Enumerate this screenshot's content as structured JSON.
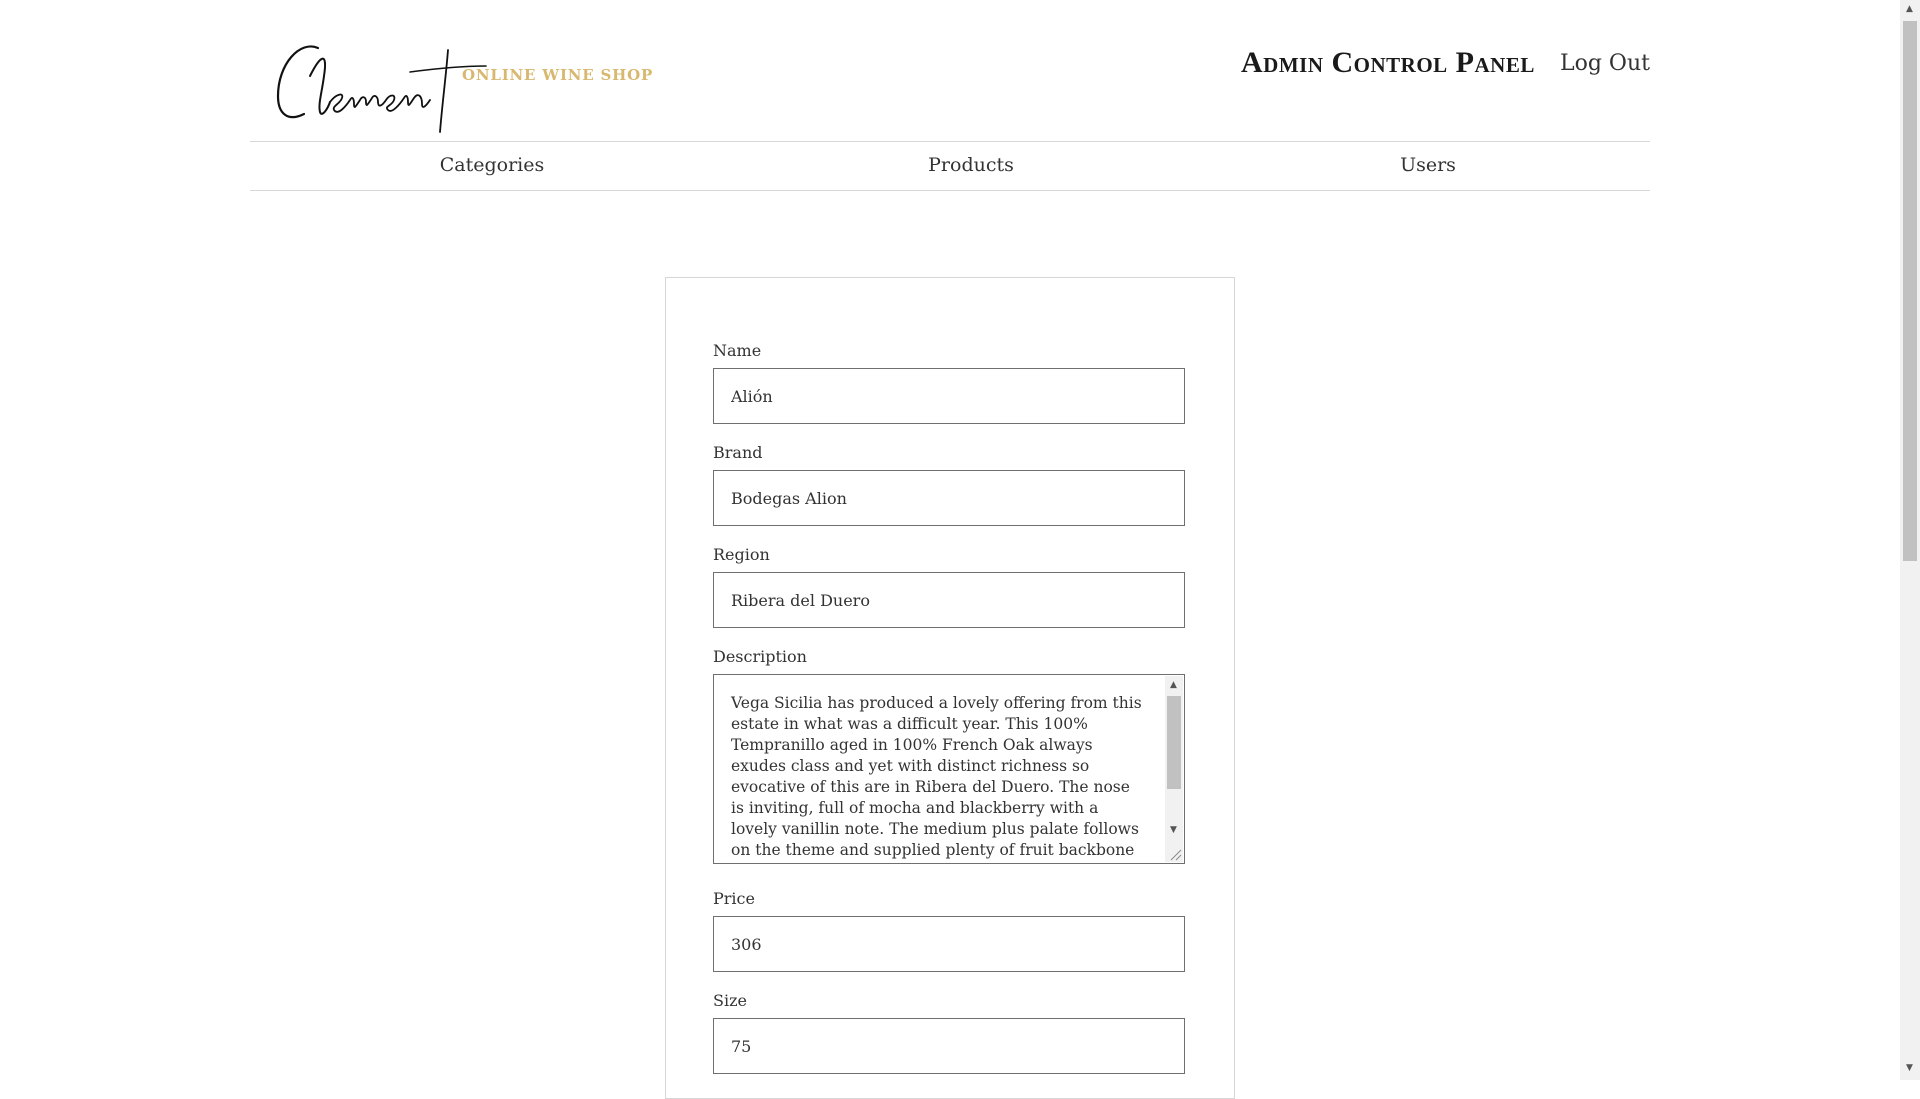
{
  "header": {
    "logo_script": "Clement",
    "logo_tagline": "ONLINE WINE SHOP",
    "admin_title": "Admin Control Panel",
    "logout_label": "Log Out"
  },
  "nav": {
    "items": [
      {
        "label": "Categories"
      },
      {
        "label": "Products"
      },
      {
        "label": "Users"
      }
    ]
  },
  "form": {
    "name": {
      "label": "Name",
      "value": "Alión"
    },
    "brand": {
      "label": "Brand",
      "value": "Bodegas Alion"
    },
    "region": {
      "label": "Region",
      "value": "Ribera del Duero"
    },
    "description": {
      "label": "Description",
      "value": "Vega Sicilia has produced a lovely offering from this estate in what was a difficult year. This 100% Tempranillo aged in 100% French Oak always exudes class and yet with distinct richness so evocative of this are in Ribera del Duero. The nose is inviting, full of mocha and blackberry with a lovely vanillin note. The medium plus palate follows on the theme and supplied plenty of fruit backbone with a lovely smoky finish. This, would be the perfect accompaniment to a cut of meat."
    },
    "price": {
      "label": "Price",
      "value": "306"
    },
    "size": {
      "label": "Size",
      "value": "75"
    }
  }
}
